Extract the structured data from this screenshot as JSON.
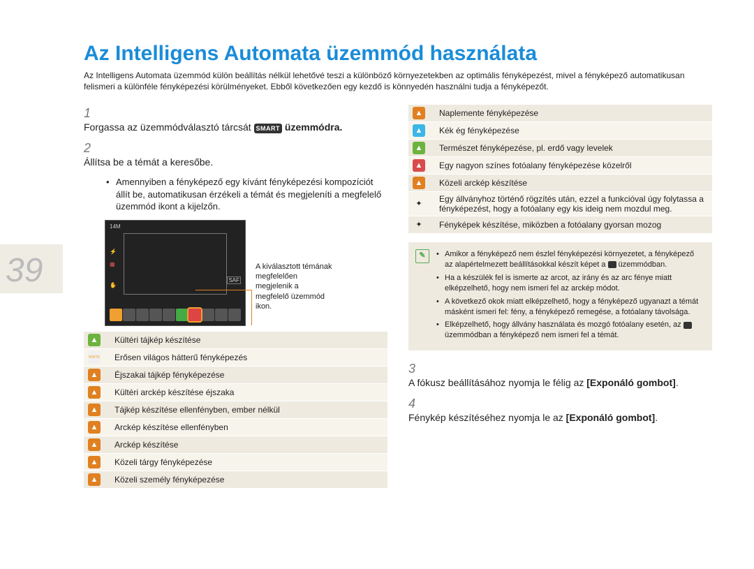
{
  "page_number": "39",
  "title": "Az Intelligens Automata üzemmód használata",
  "intro": "Az Intelligens Automata üzemmód külön beállítás nélkül lehetővé teszi a különböző környezetekben az optimális fényképezést, mivel a fényképező automatikusan felismeri a különféle fényképezési körülményeket. Ebből következően egy kezdő is könnyedén használni tudja a fényképezőt.",
  "steps": {
    "s1_a": "Forgassa az üzemmódválasztó tárcsát ",
    "s1_badge": "SMART",
    "s1_b": " üzemmódra.",
    "s2": "Állítsa be a témát a keresőbe.",
    "s2_bullet": "Amennyiben a fényképező egy kívánt fényképezési kompozíciót állít be, automatikusan érzékeli a témát és megjeleníti a megfelelő üzemmód ikont a kijelzőn.",
    "s3_a": "A fókusz beállításához nyomja le félig az ",
    "s3_b": "[Exponáló gombot]",
    "s3_c": ".",
    "s4_a": "Fénykép készítéséhez nyomja le az ",
    "s4_b": "[Exponáló gombot]",
    "s4_c": "."
  },
  "callout": "A kiválasztott témának megfelelően megjelenik a megfelelő üzemmód ikon.",
  "screen": {
    "res": "14M",
    "af": "SAF"
  },
  "left_table": [
    {
      "c": "#6db33f",
      "t": "Kültéri tájkép készítése"
    },
    {
      "c": "#f0f0f0",
      "t": "Erősen világos hátterű fényképezés",
      "fg": "#f0a030",
      "label": "WHITE"
    },
    {
      "c": "#e08020",
      "t": "Éjszakai tájkép fényképezése"
    },
    {
      "c": "#e08020",
      "t": "Kültéri arckép készítése éjszaka"
    },
    {
      "c": "#e08020",
      "t": "Tájkép készítése ellenfényben, ember nélkül"
    },
    {
      "c": "#e08020",
      "t": "Arckép készítése ellenfényben"
    },
    {
      "c": "#e08020",
      "t": "Arckép készítése"
    },
    {
      "c": "#e08020",
      "t": "Közeli tárgy fényképezése"
    },
    {
      "c": "#e08020",
      "t": "Közeli személy fényképezése"
    }
  ],
  "right_table": [
    {
      "c": "#e08020",
      "t": "Naplemente fényképezése"
    },
    {
      "c": "#3bb6e6",
      "t": "Kék ég fényképezése"
    },
    {
      "c": "#6db33f",
      "t": "Természet fényképezése, pl. erdő vagy levelek"
    },
    {
      "c": "#d94c4c",
      "t": "Egy nagyon színes fotóalany fényképezése közelről"
    },
    {
      "c": "#e08020",
      "t": "Közeli arckép készítése"
    },
    {
      "c": "#222",
      "t": "Egy állványhoz történő rögzítés után, ezzel a funkcióval úgy folytassa a fényképezést, hogy a fotóalany egy kis ideig nem mozdul meg.",
      "plain": true
    },
    {
      "c": "#222",
      "t": "Fényképek készítése, miközben a fotóalany gyorsan mozog",
      "plain": true
    }
  ],
  "notes": [
    "Amikor a fényképező nem észlel fényképezési környezetet, a fényképező az alapértelmezett beállításokkal készít képet a  üzemmódban.",
    "Ha a készülék fel is ismerte az arcot, az irány és az arc fénye miatt elképzelhető, hogy nem ismeri fel az arckép módot.",
    "A következő okok miatt elképzelhető, hogy a fényképező ugyanazt a témát másként ismeri fel: fény, a fényképező remegése, a fotóalany távolsága.",
    "Elképzelhető, hogy állvány használata és mozgó fotóalany esetén, az  üzemmódban a fényképező nem ismeri fel a témát."
  ]
}
